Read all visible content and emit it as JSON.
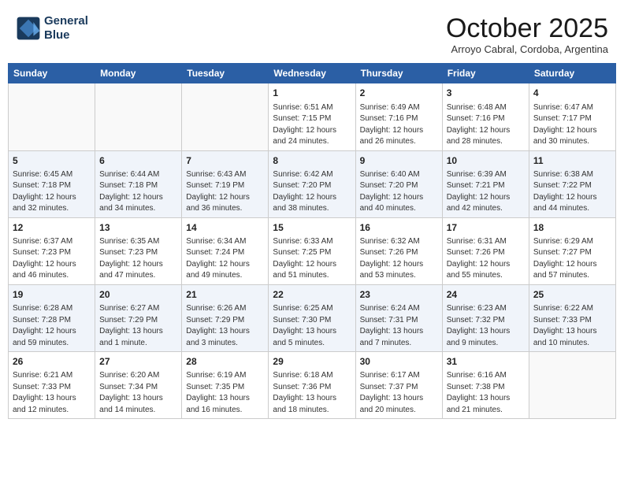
{
  "header": {
    "logo_line1": "General",
    "logo_line2": "Blue",
    "month": "October 2025",
    "location": "Arroyo Cabral, Cordoba, Argentina"
  },
  "weekdays": [
    "Sunday",
    "Monday",
    "Tuesday",
    "Wednesday",
    "Thursday",
    "Friday",
    "Saturday"
  ],
  "weeks": [
    [
      {
        "day": null
      },
      {
        "day": null
      },
      {
        "day": null
      },
      {
        "day": 1,
        "sunrise": "6:51 AM",
        "sunset": "7:15 PM",
        "daylight": "12 hours and 24 minutes."
      },
      {
        "day": 2,
        "sunrise": "6:49 AM",
        "sunset": "7:16 PM",
        "daylight": "12 hours and 26 minutes."
      },
      {
        "day": 3,
        "sunrise": "6:48 AM",
        "sunset": "7:16 PM",
        "daylight": "12 hours and 28 minutes."
      },
      {
        "day": 4,
        "sunrise": "6:47 AM",
        "sunset": "7:17 PM",
        "daylight": "12 hours and 30 minutes."
      }
    ],
    [
      {
        "day": 5,
        "sunrise": "6:45 AM",
        "sunset": "7:18 PM",
        "daylight": "12 hours and 32 minutes."
      },
      {
        "day": 6,
        "sunrise": "6:44 AM",
        "sunset": "7:18 PM",
        "daylight": "12 hours and 34 minutes."
      },
      {
        "day": 7,
        "sunrise": "6:43 AM",
        "sunset": "7:19 PM",
        "daylight": "12 hours and 36 minutes."
      },
      {
        "day": 8,
        "sunrise": "6:42 AM",
        "sunset": "7:20 PM",
        "daylight": "12 hours and 38 minutes."
      },
      {
        "day": 9,
        "sunrise": "6:40 AM",
        "sunset": "7:20 PM",
        "daylight": "12 hours and 40 minutes."
      },
      {
        "day": 10,
        "sunrise": "6:39 AM",
        "sunset": "7:21 PM",
        "daylight": "12 hours and 42 minutes."
      },
      {
        "day": 11,
        "sunrise": "6:38 AM",
        "sunset": "7:22 PM",
        "daylight": "12 hours and 44 minutes."
      }
    ],
    [
      {
        "day": 12,
        "sunrise": "6:37 AM",
        "sunset": "7:23 PM",
        "daylight": "12 hours and 46 minutes."
      },
      {
        "day": 13,
        "sunrise": "6:35 AM",
        "sunset": "7:23 PM",
        "daylight": "12 hours and 47 minutes."
      },
      {
        "day": 14,
        "sunrise": "6:34 AM",
        "sunset": "7:24 PM",
        "daylight": "12 hours and 49 minutes."
      },
      {
        "day": 15,
        "sunrise": "6:33 AM",
        "sunset": "7:25 PM",
        "daylight": "12 hours and 51 minutes."
      },
      {
        "day": 16,
        "sunrise": "6:32 AM",
        "sunset": "7:26 PM",
        "daylight": "12 hours and 53 minutes."
      },
      {
        "day": 17,
        "sunrise": "6:31 AM",
        "sunset": "7:26 PM",
        "daylight": "12 hours and 55 minutes."
      },
      {
        "day": 18,
        "sunrise": "6:29 AM",
        "sunset": "7:27 PM",
        "daylight": "12 hours and 57 minutes."
      }
    ],
    [
      {
        "day": 19,
        "sunrise": "6:28 AM",
        "sunset": "7:28 PM",
        "daylight": "12 hours and 59 minutes."
      },
      {
        "day": 20,
        "sunrise": "6:27 AM",
        "sunset": "7:29 PM",
        "daylight": "13 hours and 1 minute."
      },
      {
        "day": 21,
        "sunrise": "6:26 AM",
        "sunset": "7:29 PM",
        "daylight": "13 hours and 3 minutes."
      },
      {
        "day": 22,
        "sunrise": "6:25 AM",
        "sunset": "7:30 PM",
        "daylight": "13 hours and 5 minutes."
      },
      {
        "day": 23,
        "sunrise": "6:24 AM",
        "sunset": "7:31 PM",
        "daylight": "13 hours and 7 minutes."
      },
      {
        "day": 24,
        "sunrise": "6:23 AM",
        "sunset": "7:32 PM",
        "daylight": "13 hours and 9 minutes."
      },
      {
        "day": 25,
        "sunrise": "6:22 AM",
        "sunset": "7:33 PM",
        "daylight": "13 hours and 10 minutes."
      }
    ],
    [
      {
        "day": 26,
        "sunrise": "6:21 AM",
        "sunset": "7:33 PM",
        "daylight": "13 hours and 12 minutes."
      },
      {
        "day": 27,
        "sunrise": "6:20 AM",
        "sunset": "7:34 PM",
        "daylight": "13 hours and 14 minutes."
      },
      {
        "day": 28,
        "sunrise": "6:19 AM",
        "sunset": "7:35 PM",
        "daylight": "13 hours and 16 minutes."
      },
      {
        "day": 29,
        "sunrise": "6:18 AM",
        "sunset": "7:36 PM",
        "daylight": "13 hours and 18 minutes."
      },
      {
        "day": 30,
        "sunrise": "6:17 AM",
        "sunset": "7:37 PM",
        "daylight": "13 hours and 20 minutes."
      },
      {
        "day": 31,
        "sunrise": "6:16 AM",
        "sunset": "7:38 PM",
        "daylight": "13 hours and 21 minutes."
      },
      {
        "day": null
      }
    ]
  ]
}
